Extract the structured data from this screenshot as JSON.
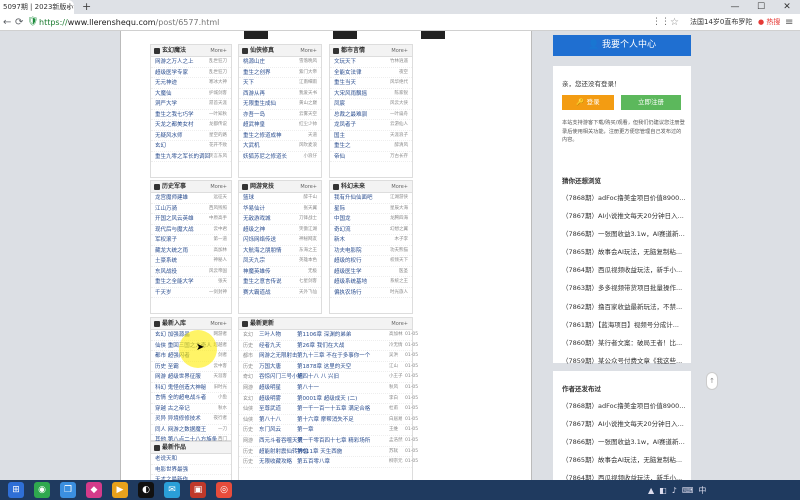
{
  "browser": {
    "tab_title": "5097期 | 2023新版小说三",
    "tab_close": "×",
    "new_tab": "+",
    "url_prefix": "https://",
    "url_domain": "www.llerenshequ.com",
    "url_path": "/post/6577.html",
    "news_ticker": "法国14岁0直布罗陀",
    "hot_badge": "● 热搜",
    "win_min": "—",
    "win_max": "☐",
    "win_close": "✕",
    "nav_back": "←",
    "nav_forward": "→",
    "nav_reload": "⟳",
    "secure_icon": "🛡",
    "grid_icon": "⋮⋮",
    "star_icon": "☆",
    "menu_icon": "≡"
  },
  "main": {
    "more_label": "More+",
    "sections": [
      {
        "title": "玄幻魔法",
        "rows": [
          {
            "t": "网游之万人之上",
            "a": "乱世狂刀"
          },
          {
            "t": "超级医学专家",
            "a": "乱世狂刀"
          },
          {
            "t": "无元神迹",
            "a": "寒冰大神"
          },
          {
            "t": "大魔仙",
            "a": "护城剑客"
          },
          {
            "t": "洞严大学",
            "a": "昂首天涯"
          },
          {
            "t": "重生之我七巧学",
            "a": "一叶知秋"
          },
          {
            "t": "天龙之都美女村",
            "a": "龙都传说"
          },
          {
            "t": "无疑风水师",
            "a": "星空的路"
          },
          {
            "t": "玄幻",
            "a": "花开不败"
          },
          {
            "t": "重生九零之军长的调回",
            "a": "笑言东风"
          }
        ]
      },
      {
        "title": "仙侠修真",
        "rows": [
          {
            "t": "桃源山庄",
            "a": "雪落晚风"
          },
          {
            "t": "重生之创界",
            "a": "紫门大帝"
          },
          {
            "t": "天下",
            "a": "江南细雨"
          },
          {
            "t": "西游从再",
            "a": "我爱天书"
          },
          {
            "t": "无限重生成仙",
            "a": "黄山之巅"
          },
          {
            "t": "亦吾一岛",
            "a": "云雾天空"
          },
          {
            "t": "超武神皇",
            "a": "红尘少帅"
          },
          {
            "t": "重生之修道成神",
            "a": "天道"
          },
          {
            "t": "大武机",
            "a": "风吹麦浪"
          },
          {
            "t": "妖狐苏尼之修道长",
            "a": "小浪仔"
          }
        ]
      },
      {
        "title": "都市言情",
        "rows": [
          {
            "t": "文玩天下",
            "a": "竹林逍遥"
          },
          {
            "t": "全能女法律",
            "a": "夜空"
          },
          {
            "t": "重生当天",
            "a": "风华绝代"
          },
          {
            "t": "大宋风雨飘摇",
            "a": "陈家锐"
          },
          {
            "t": "凤宸",
            "a": "风云大侠"
          },
          {
            "t": "总裁之最难驯",
            "a": "一叶扁舟"
          },
          {
            "t": "龙凤者子",
            "a": "云游仙人"
          },
          {
            "t": "国主",
            "a": "天涯浪子"
          },
          {
            "t": "重生之",
            "a": "醉清风"
          },
          {
            "t": "帝仙",
            "a": "万古长存"
          }
        ]
      },
      {
        "title": "历史军事",
        "rows": [
          {
            "t": "龙宫魔师建雄",
            "a": "远征天"
          },
          {
            "t": "江山万骑",
            "a": "西风残照"
          },
          {
            "t": "开国之风云英雄",
            "a": "中原高手"
          },
          {
            "t": "现代后与魔大战",
            "a": "云中君"
          },
          {
            "t": "军权滚子",
            "a": "第一道"
          },
          {
            "t": "藏龙大统之雨",
            "a": "高加林"
          },
          {
            "t": "土豪系统",
            "a": "神秘人"
          },
          {
            "t": "东风战役",
            "a": "风云帝国"
          },
          {
            "t": "重生之全能大学",
            "a": "张天"
          },
          {
            "t": "千天岁",
            "a": "一剑封神"
          }
        ]
      },
      {
        "title": "网游竞技",
        "rows": [
          {
            "t": "篮球",
            "a": "醉千山"
          },
          {
            "t": "华易仙计",
            "a": "张天翼"
          },
          {
            "t": "无敌游戏城",
            "a": "刀锋战士"
          },
          {
            "t": "超级之神",
            "a": "笑傲江湖"
          },
          {
            "t": "闪烁网络传送",
            "a": "神秘网友"
          },
          {
            "t": "大航海之朋朋情",
            "a": "东海之王"
          },
          {
            "t": "凤天九宗",
            "a": "英雄本色"
          },
          {
            "t": "神魔英雄传",
            "a": "无极"
          },
          {
            "t": "重生之意言传说",
            "a": "七星剑客"
          },
          {
            "t": "赛大霸道战",
            "a": "天外飞仙"
          }
        ]
      },
      {
        "title": "科幻未来",
        "rows": [
          {
            "t": "我有升仙仙面吧",
            "a": "江湖游侠"
          },
          {
            "t": "星际",
            "a": "星辰大海"
          },
          {
            "t": "中国龙",
            "a": "龙腾四海"
          },
          {
            "t": "奇幻流",
            "a": "幻想之翼"
          },
          {
            "t": "新木",
            "a": "木子李"
          },
          {
            "t": "功夫电影院",
            "a": "功夫熊猫"
          },
          {
            "t": "超级的权行",
            "a": "权倾天下"
          },
          {
            "t": "超级医生学",
            "a": "医圣"
          },
          {
            "t": "超级系统基地",
            "a": "系统之王"
          },
          {
            "t": "偏执农场行",
            "a": "时光旅人"
          }
        ]
      }
    ],
    "ranking": {
      "title": "最新入库",
      "rows": [
        {
          "t": "玄幻 加强源晶",
          "a": "网游者"
        },
        {
          "t": "仙侠 重回三国之大奇人",
          "a": "超越者"
        },
        {
          "t": "都市 超强闪者",
          "a": "剑者"
        },
        {
          "t": "历史 至霸",
          "a": "云中客"
        },
        {
          "t": "网游 超级世界征服",
          "a": "天涯客"
        },
        {
          "t": "科幻 鬼怪创造大神秘",
          "a": "旧时光"
        },
        {
          "t": "言情 全的超电战斗者",
          "a": "小鱼"
        },
        {
          "t": "穿越 古之帝记",
          "a": "秋水"
        },
        {
          "t": "灵异 异境修修技术",
          "a": "夜行者"
        },
        {
          "t": "同人 网游之数据魔王",
          "a": "一刀"
        },
        {
          "t": "其他 第八点二十八方族条",
          "a": "西门"
        },
        {
          "t": "玄幻 重生之教馆主",
          "a": "老孙"
        }
      ]
    },
    "category_box": {
      "title": "最新作品",
      "rows": [
        {
          "t": "老说天和"
        },
        {
          "t": "电影世界最强"
        },
        {
          "t": "天才之最新作"
        }
      ]
    },
    "updates": {
      "title": "最新更新",
      "rows": [
        {
          "cat": "玄幻",
          "nm": "三叶人物",
          "ch": "第1106章 深渊的弟弟",
          "au": "高加林",
          "dt": "01-05"
        },
        {
          "cat": "历史",
          "nm": "经者九天",
          "ch": "第26章 我们在大战",
          "au": "冷无情",
          "dt": "01-05"
        },
        {
          "cat": "都市",
          "nm": "网游之无限射击",
          "ch": "第九十三章 不在于多事你一个",
          "au": "吴洪",
          "dt": "01-05"
        },
        {
          "cat": "历史",
          "nm": "万国大唐",
          "ch": "第1878章 这里的天空",
          "au": "江山",
          "dt": "01-05"
        },
        {
          "cat": "奇幻",
          "nm": "吞惊闪门三号小组",
          "ch": "第四十八 八 兴旧",
          "au": "小王子",
          "dt": "01-05"
        },
        {
          "cat": "网游",
          "nm": "超级明星",
          "ch": "第八十一 ",
          "au": "秋风",
          "dt": "01-05"
        },
        {
          "cat": "玄幻",
          "nm": "超级明雾",
          "ch": "第0001章 超级成天 (二)",
          "au": "李白",
          "dt": "01-05"
        },
        {
          "cat": "仙侠",
          "nm": "至尊武道",
          "ch": "第一千一百一十五章 满足合格",
          "au": "杜甫",
          "dt": "01-05"
        },
        {
          "cat": "仙侠",
          "nm": "第八十八",
          "ch": "第十六章 摩帮消失不足",
          "au": "白居易",
          "dt": "01-05"
        },
        {
          "cat": "历史",
          "nm": "东门风云",
          "ch": "第一章",
          "au": "王维",
          "dt": "01-05"
        },
        {
          "cat": "网游",
          "nm": "西元斗者吞噬天灵",
          "ch": "第一千零百四十七章 精彩场所",
          "au": "孟浩然",
          "dt": "01-05"
        },
        {
          "cat": "历史",
          "nm": "超能射射震仙转神兽",
          "ch": "第511章 天生西施",
          "au": "苏轼",
          "dt": "01-05"
        },
        {
          "cat": "历史",
          "nm": "无限收藏攻略",
          "ch": "第五百零八章",
          "au": "柳宗元",
          "dt": "01-05"
        }
      ]
    }
  },
  "sidebar": {
    "my_center_label": "👤 我要个人中心",
    "login_msg": "亲，您还没有登录！",
    "login_label": "🔑 登录",
    "register_label": "立即注册",
    "login_desc": "本站支持游客下载/购买/观看，但我们仍建议您注册登录后使用相关功能，注册更方便您管理自己发布过的内容。",
    "recommend_title": "猜你还想浏览",
    "recommend_items": [
      "（7868期）adFoc撸美金项目价值8900...",
      "（7867期）AI小说推文每天20分钟日入...",
      "（7866期）一张图收益3.1w，AI赛道新...",
      "（7865期）故事会AI玩法，无脑复制粘...",
      "（7864期）西瓜视频收益玩法，新手小...",
      "（7863期）多多视频带货项目批量操作...",
      "（7862期）撸百家收益最新玩法，不禁...",
      "（7861期）【蓝海项目】视频号分成计...",
      "（7860期）某行者文案：破局王者！比...",
      "（7859期）某公众号付费文章《我这些..."
    ],
    "recent_title": "作者还发布过",
    "recent_items": [
      "（7868期）adFoc撸美金项目价值8900...",
      "（7867期）AI小说推文每天20分钟日入...",
      "（7866期）一张图收益3.1w，AI赛道新...",
      "（7865期）故事会AI玩法，无脑复制粘...",
      "（7864期）西瓜视频收益玩法，新手小..."
    ],
    "back_top": "↑"
  },
  "taskbar": {
    "items": [
      "⊞",
      "◉",
      "❐",
      "◆",
      "▶",
      "◐",
      "✉",
      "▣",
      "◎"
    ],
    "tray": [
      "▲",
      "◧",
      "♪",
      "⌨",
      "中"
    ]
  }
}
